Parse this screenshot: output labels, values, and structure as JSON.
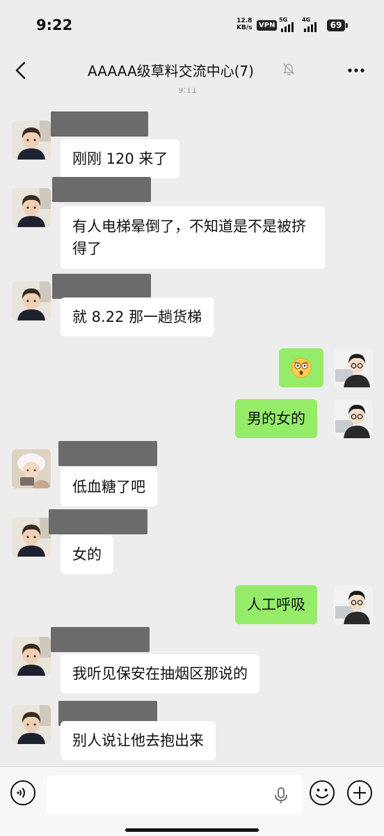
{
  "status_bar": {
    "time": "9:22",
    "net_speed_value": "12.8",
    "net_speed_unit": "KB/s",
    "vpn": "VPN",
    "sig1": "5G",
    "sig2": "4G",
    "battery": "69"
  },
  "nav": {
    "title": "AAAAA级草料交流中心(7)",
    "time_separator": "9:11"
  },
  "messages": [
    {
      "text": "刚刚 120 来了",
      "direction": "incoming"
    },
    {
      "text": "有人电梯晕倒了，不知道是不是被挤得了",
      "direction": "incoming"
    },
    {
      "text": "就 8.22 那一趟货梯",
      "direction": "incoming"
    },
    {
      "text": "",
      "direction": "outgoing",
      "content": "shocked-emoji"
    },
    {
      "text": "男的女的",
      "direction": "outgoing"
    },
    {
      "text": "低血糖了吧",
      "direction": "incoming"
    },
    {
      "text": "女的",
      "direction": "incoming"
    },
    {
      "text": "人工呼吸",
      "direction": "outgoing"
    },
    {
      "text": "我听见保安在抽烟区那说的",
      "direction": "incoming"
    },
    {
      "text": "别人说让他去抱出来",
      "direction": "incoming"
    }
  ],
  "colors": {
    "background": "#ededed",
    "outgoing_bubble": "#95ec69",
    "incoming_bubble": "#ffffff",
    "redacted_name": "#6b6b6b"
  },
  "icons": {
    "back": "chevron-left-icon",
    "mute": "bell-off-icon",
    "more": "more-dots-icon",
    "voice": "voice-wave-icon",
    "mic": "mic-icon",
    "emoji": "smile-icon",
    "plus": "plus-icon"
  }
}
